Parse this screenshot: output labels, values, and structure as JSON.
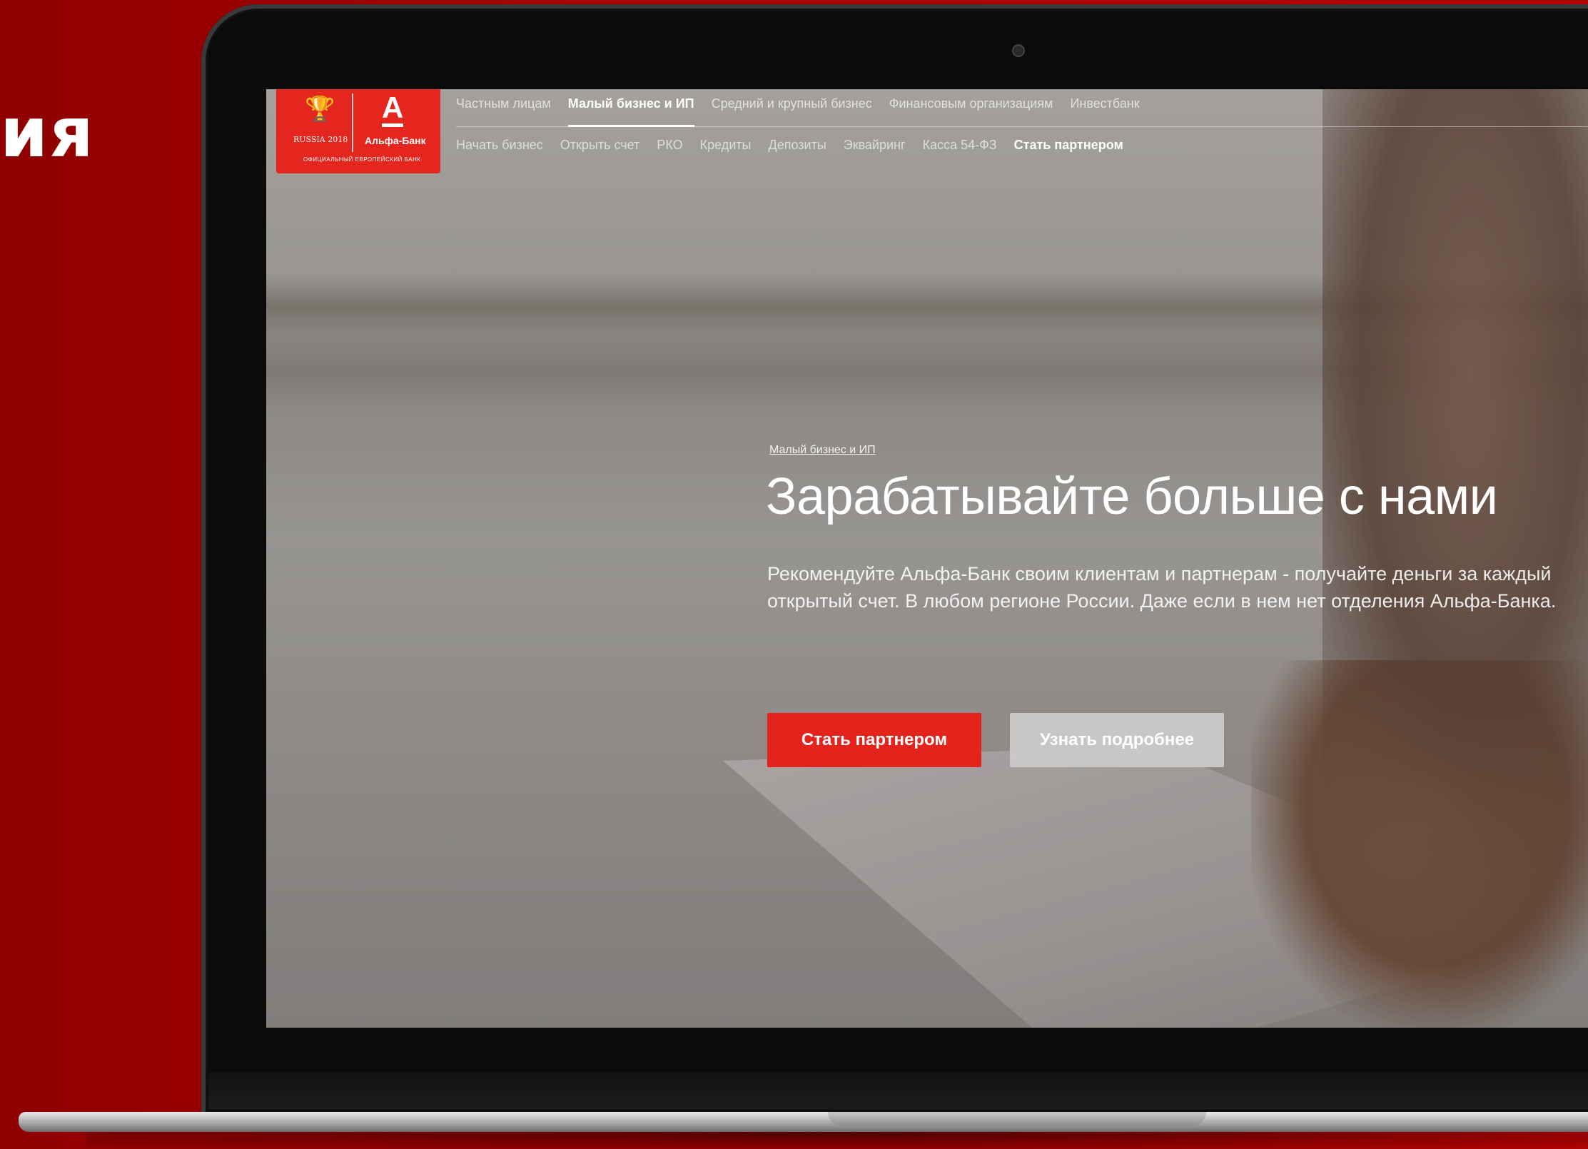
{
  "slide": {
    "title_fragment": "ия"
  },
  "site": {
    "logo": {
      "cup_text": "RUSSIA 2018",
      "bank_name": "Альфа-Банк",
      "bank_letter": "А",
      "tagline": "ОФИЦИАЛЬНЫЙ ЕВРОПЕЙСКИЙ БАНК"
    },
    "nav_top": [
      {
        "label": "Частным лицам"
      },
      {
        "label": "Малый бизнес и ИП"
      },
      {
        "label": "Средний и крупный бизнес"
      },
      {
        "label": "Финансовым организациям"
      },
      {
        "label": "Инвестбанк"
      }
    ],
    "nav_sub": [
      {
        "label": "Начать бизнес"
      },
      {
        "label": "Открыть счет"
      },
      {
        "label": "РКО"
      },
      {
        "label": "Кредиты"
      },
      {
        "label": "Депозиты"
      },
      {
        "label": "Эквайринг"
      },
      {
        "label": "Касса 54-ФЗ"
      },
      {
        "label": "Стать партнером"
      }
    ],
    "hero": {
      "breadcrumb": "Малый бизнес и ИП",
      "title": "Зарабатывайте больше с нами",
      "description": "Рекомендуйте Альфа-Банк своим клиентам и партнерам - получайте деньги за каждый открытый счет. В любом регионе России. Даже если в нем нет отделения Альфа-Банка.",
      "primary_button": "Стать партнером",
      "secondary_button": "Узнать подробнее"
    }
  },
  "colors": {
    "slide_background": "#a80000",
    "brand_red": "#e5261f",
    "secondary_button": "#cdcccb"
  }
}
